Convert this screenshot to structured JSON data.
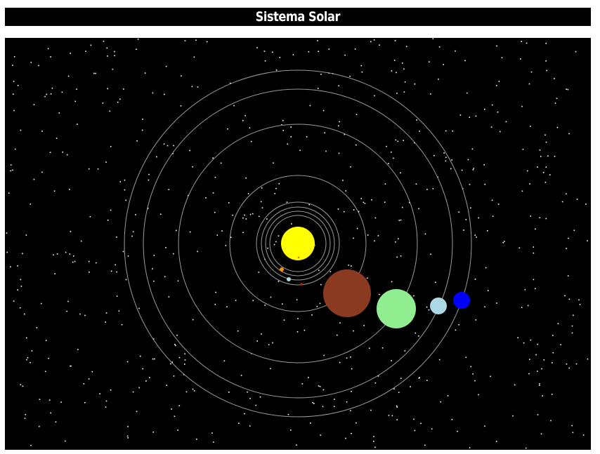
{
  "header": {
    "title": "Sistema Solar"
  },
  "scene": {
    "background_color": "#000000",
    "orbit_color": "#9a9a9a",
    "star_color": "#ffffff",
    "sun_color": "#ffff00",
    "planet_colors": {
      "mercury": "#d2691e",
      "venus": "#ff8c00",
      "earth": "#add8e6",
      "mars": "#cc2200",
      "jupiter": "#8b3a22",
      "saturn": "#90ee90",
      "uranus": "#add8e6",
      "neptune": "#0000ff"
    }
  }
}
